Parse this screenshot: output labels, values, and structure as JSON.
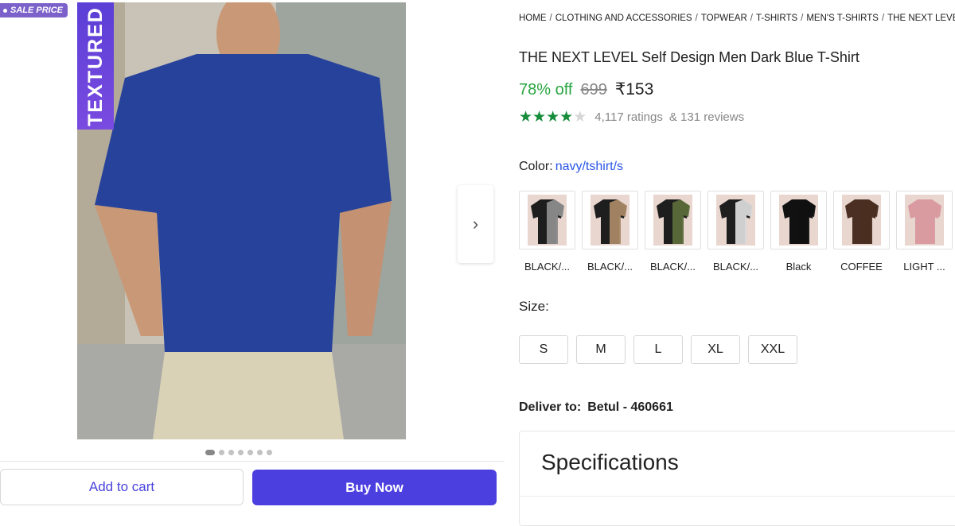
{
  "badge": {
    "sale_label": "SALE PRICE"
  },
  "gallery": {
    "banner_text": "TEXTURED",
    "dots_count": 7,
    "active_dot": 0
  },
  "actions": {
    "add_to_cart": "Add to cart",
    "buy_now": "Buy Now"
  },
  "breadcrumb": [
    "HOME",
    "CLOTHING AND ACCESSORIES",
    "TOPWEAR",
    "T-SHIRTS",
    "MEN'S T-SHIRTS",
    "THE NEXT LEVEL"
  ],
  "product": {
    "title": "THE NEXT LEVEL Self Design Men Dark Blue T-Shirt",
    "discount": "78% off",
    "mrp": "699",
    "price": "₹153",
    "stars": 4,
    "ratings": "4,117 ratings",
    "reviews": "& 131 reviews"
  },
  "color": {
    "label": "Color:",
    "selected": "navy/tshirt/s",
    "swatches": [
      {
        "label": "BLACK/...",
        "c1": "#1e1e1e",
        "c2": "#8c8c8c"
      },
      {
        "label": "BLACK/...",
        "c1": "#1e1e1e",
        "c2": "#a88866"
      },
      {
        "label": "BLACK/...",
        "c1": "#1e1e1e",
        "c2": "#5b6b3a"
      },
      {
        "label": "BLACK/...",
        "c1": "#1e1e1e",
        "c2": "#d9d9d9"
      },
      {
        "label": "Black",
        "c1": "#111111",
        "c2": "#111111"
      },
      {
        "label": "COFFEE",
        "c1": "#4a2f22",
        "c2": "#4a2f22"
      },
      {
        "label": "LIGHT ...",
        "c1": "#d99aa0",
        "c2": "#d99aa0"
      }
    ]
  },
  "size": {
    "label": "Size:",
    "options": [
      "S",
      "M",
      "L",
      "XL",
      "XXL"
    ]
  },
  "delivery": {
    "label": "Deliver to:",
    "location": "Betul - 460661"
  },
  "specifications": {
    "title": "Specifications"
  },
  "colors": {
    "accent": "#4c3fe0",
    "discount_green": "#26a541",
    "link_blue": "#2a55e5"
  }
}
